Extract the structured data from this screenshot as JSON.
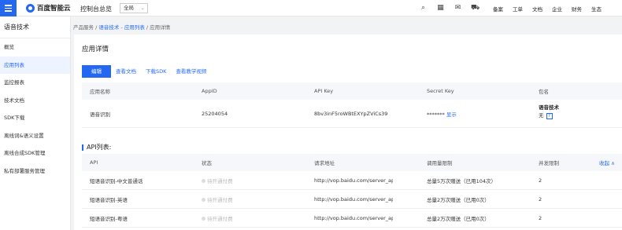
{
  "topbar": {
    "logo_text": "百度智能云",
    "console_title": "控制台总览",
    "region_value": "全局",
    "icons": [
      "search-icon",
      "grid-icon",
      "message-icon",
      "cart-icon"
    ],
    "links": [
      "备案",
      "工单",
      "文档",
      "企业",
      "财务",
      "生态"
    ]
  },
  "sidebar": {
    "title": "语音技术",
    "items": [
      {
        "label": "概览"
      },
      {
        "label": "应用列表"
      },
      {
        "label": "监控报表"
      },
      {
        "label": "技术文档"
      },
      {
        "label": "SDK下载"
      },
      {
        "label": "离线词&语义设置"
      },
      {
        "label": "离线合成SDK管理"
      },
      {
        "label": "私有部署服务管理"
      }
    ]
  },
  "breadcrumb": {
    "part1": "产品服务 /",
    "part2": "语音技术 - 应用列表",
    "part3": "/ 应用详情"
  },
  "panel": {
    "title": "应用详情",
    "tabs": [
      "编辑",
      "查看文档",
      "下载SDK",
      "查看教学视频"
    ]
  },
  "app_table": {
    "headers": [
      "应用名称",
      "AppID",
      "API Key",
      "Secret Key",
      "包名"
    ],
    "row": {
      "name": "语音识别",
      "appid": "25204054",
      "api_key": "8bv3inF5roWBtEXYpZViCs39",
      "secret_mask": "******* ",
      "secret_show": "显示",
      "pkg_type": "语音技术",
      "pkg_value": "无",
      "pkg_help": "?"
    }
  },
  "api_section": {
    "title": "API列表:",
    "headers": [
      "API",
      "状态",
      "请求地址",
      "调用量限制",
      "并发限制"
    ],
    "collapse": "收起 ∧",
    "rows": [
      {
        "api": "短语音识别-中文普通话",
        "status": "待开通付费",
        "url": "http://vop.baidu.com/server_api",
        "limit": "总量5万次赠送（已用104次）",
        "qps": "2"
      },
      {
        "api": "短语音识别-英语",
        "status": "待开通付费",
        "url": "http://vop.baidu.com/server_api",
        "limit": "总量2万次赠送（已用0次）",
        "qps": "2"
      },
      {
        "api": "短语音识别-粤语",
        "status": "待开通付费",
        "url": "http://vop.baidu.com/server_api",
        "limit": "总量2万次赠送（已用0次）",
        "qps": "2"
      }
    ]
  }
}
